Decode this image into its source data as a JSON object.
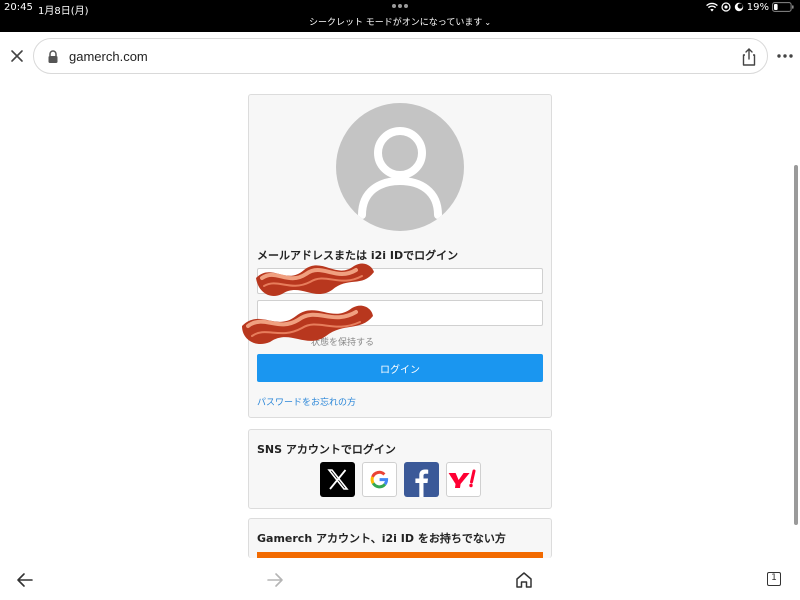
{
  "status": {
    "time": "20:45",
    "date": "1月8日(月)",
    "battery": "19%",
    "incognito_notice": "シークレット モードがオンになっています"
  },
  "browser": {
    "url": "gamerch.com"
  },
  "login": {
    "heading": "メールアドレスまたは i2i IDでログイン",
    "email_value": "",
    "password_value": "",
    "remember_label": "状態を保持する",
    "login_button": "ログイン",
    "forgot_link": "パスワードをお忘れの方"
  },
  "sns": {
    "heading": "SNS アカウントでログイン",
    "providers": [
      "x-icon",
      "google-icon",
      "facebook-icon",
      "yahoo-icon"
    ]
  },
  "register": {
    "heading": "Gamerch アカウント、i2i ID をお持ちでない方"
  },
  "tabs": {
    "count": "1"
  },
  "colors": {
    "login_button": "#1a96f0",
    "link": "#2a86d8",
    "register_button": "#f26a00"
  }
}
